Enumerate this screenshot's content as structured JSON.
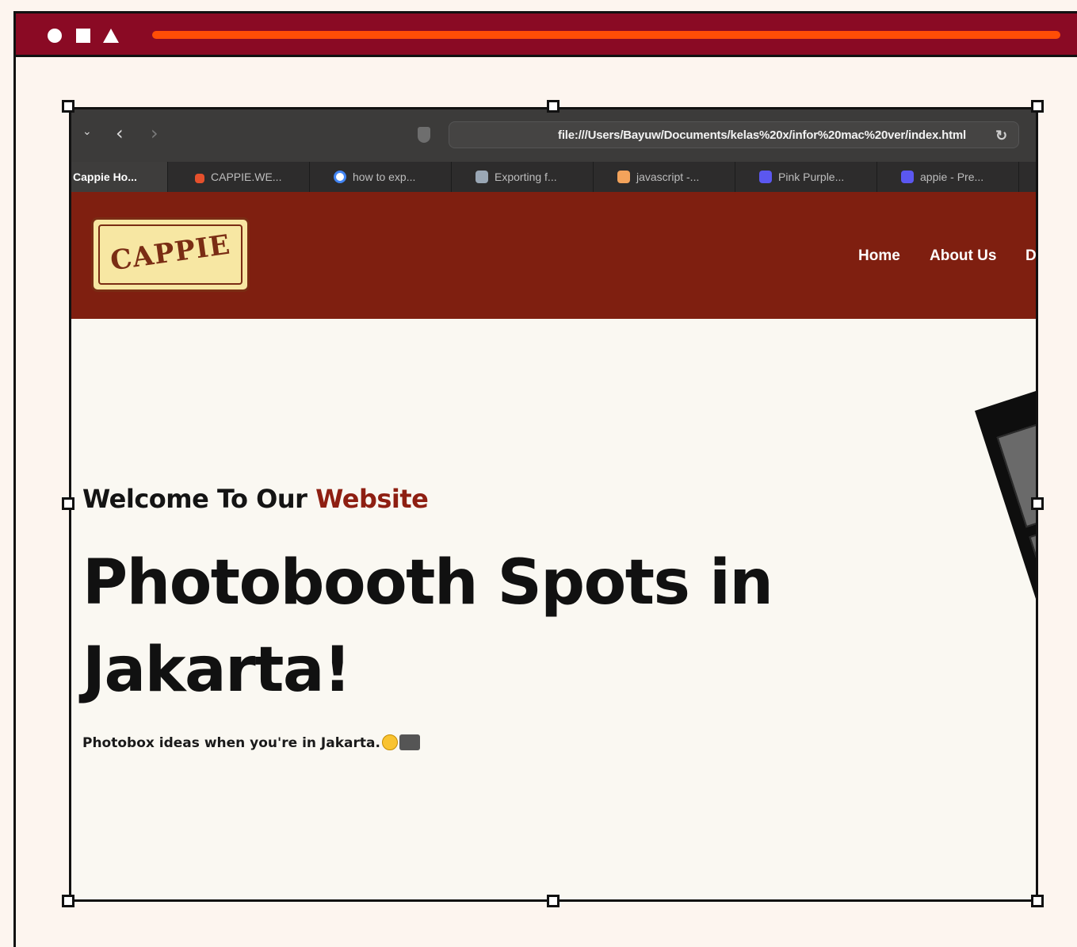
{
  "window": {
    "accent": "#8a0a24",
    "bar_color": "#ff4d06"
  },
  "browser": {
    "url": "file:///Users/Bayuw/Documents/kelas%20x/infor%20mac%20ver/index.html",
    "icons": [
      "chevron-down-icon",
      "back-icon",
      "forward-icon",
      "shield-icon",
      "reload-icon"
    ],
    "tabs": [
      {
        "label": "Cappie Ho...",
        "active": true
      },
      {
        "label": "CAPPIE.WE...",
        "active": false
      },
      {
        "label": "how to exp...",
        "active": false
      },
      {
        "label": "Exporting f...",
        "active": false
      },
      {
        "label": "javascript -...",
        "active": false
      },
      {
        "label": "Pink Purple...",
        "active": false
      },
      {
        "label": "appie - Pre...",
        "active": false
      }
    ]
  },
  "site": {
    "logo_text": "CAPPIE",
    "nav": [
      {
        "label": "Home"
      },
      {
        "label": "About Us"
      },
      {
        "label": "D"
      }
    ],
    "hero": {
      "subtitle_prefix": "Welcome To Our ",
      "subtitle_accent": "Website",
      "title": "Photobooth Spots in Jakarta!",
      "description": "Photobox ideas when you're in Jakarta."
    },
    "colors": {
      "header": "#7f1f10",
      "accent": "#8e1f12",
      "background": "#faf8f2"
    }
  }
}
